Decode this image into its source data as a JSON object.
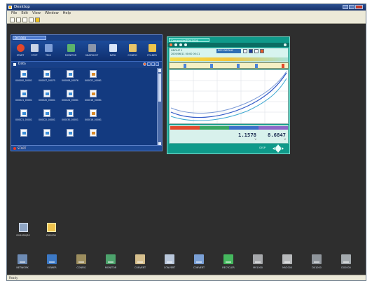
{
  "app": {
    "title": "Desktop"
  },
  "menu": [
    "File",
    "Edit",
    "View",
    "Window",
    "Help"
  ],
  "explorer": {
    "tab_label": "DX1000",
    "toolbar": [
      "START",
      "STOP",
      "TRIG",
      "MONITOR",
      "SNAPSHOT",
      "DATA",
      "CONFIG",
      "FOLDER"
    ],
    "section_label": "Data",
    "files": [
      "000000_00001",
      "000007_00075",
      "000008_00076",
      "000022_00061",
      "000021_00001",
      "000020_00001",
      "000024_00061",
      "000016_00061",
      "000021_00001",
      "000022_00001",
      "000030_00051",
      "000016_00061",
      "",
      "",
      "",
      ""
    ],
    "footer": "START"
  },
  "trend": {
    "tab_label": "Composite@DX1000",
    "group_line": "GROUP 1",
    "date_line": "2005/06/11 00:00 00:11",
    "status_label": "REC DISPLAY",
    "values": [
      {
        "value": "1.1578",
        "unit": "V"
      },
      {
        "value": "8.6847",
        "unit": "V"
      }
    ],
    "footer_label": "DISP",
    "colors": {
      "chart_line_1": "#2f58c7",
      "chart_line_2": "#7d9bd7",
      "chart_line_3": "#3ea7d0"
    }
  },
  "desktop_icons": [
    {
      "label": "DX1000/RS",
      "icon": "device-icon"
    },
    {
      "label": "DX1000",
      "icon": "folder-icon"
    }
  ],
  "dock": [
    {
      "label": "NETWORK",
      "icon": "network-icon",
      "color": "#6d8bb4"
    },
    {
      "label": "VIEWER",
      "icon": "viewer-icon",
      "color": "#3c79c6"
    },
    {
      "label": "CONFIG",
      "icon": "config-icon",
      "color": "#9c8d5e"
    },
    {
      "label": "MONITOR",
      "icon": "monitor-icon",
      "color": "#4da36c"
    },
    {
      "label": "CONVERT",
      "icon": "convert-icon",
      "color": "#d6bf8d"
    },
    {
      "label": "CONVERT",
      "icon": "convert-icon",
      "color": "#b9c7db"
    },
    {
      "label": "CONVERT",
      "icon": "convert-icon",
      "color": "#7aa0d6"
    },
    {
      "label": "RECYCLER",
      "icon": "recycle-icon",
      "color": "#45b85e"
    },
    {
      "label": "MV1000",
      "icon": "recorder-icon",
      "color": "#a6a8ab"
    },
    {
      "label": "MV2000",
      "icon": "recorder-icon",
      "color": "#b7b9bb"
    },
    {
      "label": "DX1000",
      "icon": "recorder-icon",
      "color": "#8f959b"
    },
    {
      "label": "DX2000",
      "icon": "recorder-icon",
      "color": "#a4aaae"
    }
  ],
  "status": {
    "text": "Ready"
  }
}
